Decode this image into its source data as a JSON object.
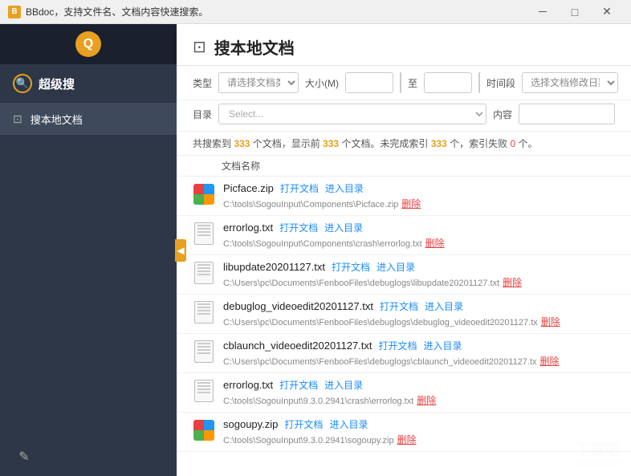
{
  "titlebar": {
    "title": "BBdoc，支持文件名、文档内容快速搜索。",
    "min": "－",
    "max": "□",
    "close": "✕"
  },
  "sidebar": {
    "search_section_label": "超级搜",
    "nav_items": [
      {
        "id": "search-local",
        "label": "搜本地文档",
        "active": true
      }
    ],
    "bottom_icon": "✎"
  },
  "content": {
    "header_icon": "🔍",
    "header_title": "搜本地文档",
    "filter": {
      "type_label": "类型",
      "type_placeholder": "请选择文档类型",
      "size_label": "大小(M)",
      "size_value": "",
      "to_label": "至",
      "time_label": "时间段",
      "time_placeholder": "选择文档修改日期"
    },
    "dir": {
      "label": "目录",
      "placeholder": "Select...",
      "content_label": "内容",
      "content_value": ""
    },
    "summary": "共搜索到 333 个文档，显示前 333 个文档。未完成索引 333 个，索引失败 0 个。",
    "summary_numbers": {
      "total": "333",
      "shown": "333",
      "pending": "333",
      "failed": "0"
    },
    "list_header": "文档名称",
    "files": [
      {
        "id": 1,
        "type": "zip",
        "name": "Picface.zip",
        "path": "C:\\tools\\SogouInput\\Components\\Picface.zip",
        "open_label": "打开文档",
        "dir_label": "进入目录",
        "delete_label": "删除"
      },
      {
        "id": 2,
        "type": "txt",
        "name": "errorlog.txt",
        "path": "C:\\tools\\SogouInput\\Components\\crash\\errorlog.txt",
        "open_label": "打开文档",
        "dir_label": "进入目录",
        "delete_label": "删除"
      },
      {
        "id": 3,
        "type": "txt",
        "name": "libupdate20201127.txt",
        "path": "C:\\Users\\pc\\Documents\\FenbooFiles\\debuglogs\\libupdate20201127.txt",
        "open_label": "打开文档",
        "dir_label": "进入目录",
        "delete_label": "删除"
      },
      {
        "id": 4,
        "type": "txt",
        "name": "debuglog_videoedit20201127.txt",
        "path": "C:\\Users\\pc\\Documents\\FenbooFiles\\debuglogs\\debuglog_videoedit20201127.tx",
        "open_label": "打开文档",
        "dir_label": "进入目录",
        "delete_label": "删除"
      },
      {
        "id": 5,
        "type": "txt",
        "name": "cblaunch_videoedit20201127.txt",
        "path": "C:\\Users\\pc\\Documents\\FenbooFiles\\debuglogs\\cblaunch_videoedit20201127.tx",
        "open_label": "打开文档",
        "dir_label": "进入目录",
        "delete_label": "删除"
      },
      {
        "id": 6,
        "type": "txt",
        "name": "errorlog.txt",
        "path": "C:\\tools\\SogouInput\\9.3.0.2941\\crash\\errorlog.txt",
        "open_label": "打开文档",
        "dir_label": "进入目录",
        "delete_label": "删除"
      },
      {
        "id": 7,
        "type": "zip",
        "name": "sogoupy.zip",
        "path": "C:\\tools\\SogouInput\\9.3.0.2941\\sogoupy.zip",
        "open_label": "打开文档",
        "dir_label": "进入目录",
        "delete_label": "删除"
      }
    ]
  }
}
